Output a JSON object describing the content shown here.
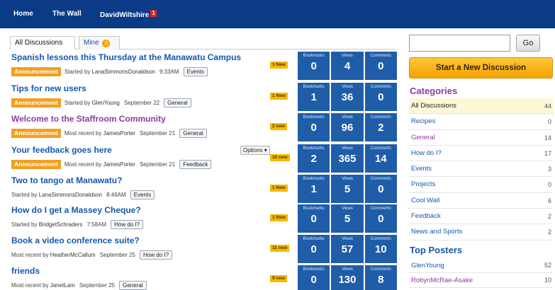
{
  "nav": {
    "home": "Home",
    "wall": "The Wall",
    "user": "DavidWiltshire",
    "user_notifications": "1"
  },
  "tabs": {
    "all": "All Discussions",
    "mine": "Mine",
    "mine_badge": "0"
  },
  "discussions": [
    {
      "title": "Spanish lessons this Thursday at the Manawatu Campus",
      "title_color": "blue",
      "announcement": "Announcement",
      "prefix": "Started by",
      "author": "LanaSimmonsDonaldson",
      "time": "9:33AM",
      "category": "Events",
      "new": "1 New",
      "bookmarks": "0",
      "views": "4",
      "comments": "0"
    },
    {
      "title": "Tips for new users",
      "title_color": "blue",
      "announcement": "Announcement",
      "prefix": "Started by",
      "author": "GlenYoung",
      "time": "September 22",
      "category": "General",
      "new": "1 New",
      "bookmarks": "1",
      "views": "36",
      "comments": "0"
    },
    {
      "title": "Welcome to the Staffroom Community",
      "title_color": "purple",
      "announcement": "Announcement",
      "prefix": "Most recent by",
      "author": "JamesPorter",
      "time": "September 21",
      "category": "General",
      "new": "2 new",
      "bookmarks": "0",
      "views": "96",
      "comments": "2"
    },
    {
      "title": "Your feedback goes here",
      "title_color": "blue",
      "announcement": "Announcement",
      "prefix": "Most recent by",
      "author": "JamesPorter",
      "time": "September 21",
      "category": "Feedback",
      "new": "10 new",
      "options": "Options ▾",
      "bookmarks": "2",
      "views": "365",
      "comments": "14"
    },
    {
      "title": "Two to tango at Manawatu?",
      "title_color": "blue",
      "announcement": "",
      "prefix": "Started by",
      "author": "LanaSimmonsDonaldson",
      "time": "8:46AM",
      "category": "Events",
      "new": "1 New",
      "bookmarks": "1",
      "views": "5",
      "comments": "0"
    },
    {
      "title": "How do I get a Massey Cheque?",
      "title_color": "blue",
      "announcement": "",
      "prefix": "Started by",
      "author": "BridgetSchraders",
      "time": "7:58AM",
      "category": "How do I?",
      "new": "1 New",
      "bookmarks": "0",
      "views": "5",
      "comments": "0"
    },
    {
      "title": "Book a video conference suite?",
      "title_color": "blue",
      "announcement": "",
      "prefix": "Most recent by",
      "author": "HeatherMcCallum",
      "time": "September 25",
      "category": "How do I?",
      "new": "11 new",
      "bookmarks": "0",
      "views": "57",
      "comments": "10"
    },
    {
      "title": "friends",
      "title_color": "blue",
      "announcement": "",
      "prefix": "Most recent by",
      "author": "JanetLam",
      "time": "September 25",
      "category": "General",
      "new": "9 new",
      "bookmarks": "0",
      "views": "130",
      "comments": "8"
    }
  ],
  "stat_labels": {
    "bookmarks": "Bookmarks",
    "views": "Views",
    "comments": "Comments"
  },
  "sidebar": {
    "search_value": "",
    "go_label": "Go",
    "start_label": "Start a New Discussion",
    "categories_heading": "Categories",
    "categories": [
      {
        "label": "All Discussions",
        "count": "44",
        "active": true
      },
      {
        "label": "Recipes",
        "count": "0"
      },
      {
        "label": "General",
        "count": "14",
        "visited": true
      },
      {
        "label": "How do I?",
        "count": "17"
      },
      {
        "label": "Events",
        "count": "3"
      },
      {
        "label": "Projects",
        "count": "0"
      },
      {
        "label": "Cool Wall",
        "count": "6"
      },
      {
        "label": "Feedback",
        "count": "2"
      },
      {
        "label": "News and Sports",
        "count": "2"
      }
    ],
    "posters_heading": "Top Posters",
    "posters": [
      {
        "label": "GlenYoung",
        "count": "52"
      },
      {
        "label": "RobynMcRae-Asake",
        "count": "10",
        "visited": true
      }
    ]
  },
  "colors": {
    "nav_bg": "#0b3b86",
    "link_blue": "#1557b0",
    "visited_purple": "#8e3aa5",
    "stat_blue": "#1f5da8",
    "announcement_orange": "#f0a020",
    "new_yellow": "#f5b800",
    "start_button": "#f3a300"
  }
}
